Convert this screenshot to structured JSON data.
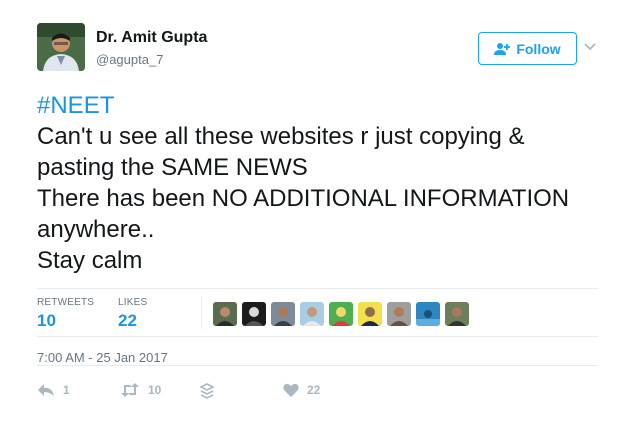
{
  "author": {
    "name": "Dr. Amit Gupta",
    "handle": "@agupta_7"
  },
  "follow_button": {
    "label": "Follow"
  },
  "tweet": {
    "hashtag": "#NEET",
    "lines": [
      "Can't u see all these websites r just copying &",
      "pasting the SAME NEWS",
      "There has been NO ADDITIONAL INFORMATION",
      "anywhere..",
      "Stay calm"
    ]
  },
  "stats": {
    "retweets_label": "RETWEETS",
    "retweets_value": "10",
    "likes_label": "LIKES",
    "likes_value": "22"
  },
  "liker_count_shown": 9,
  "timestamp": "7:00 AM - 25 Jan 2017",
  "actions": {
    "reply_count": "1",
    "retweet_count": "10",
    "like_count": "22"
  },
  "colors": {
    "accent": "#1da1f2",
    "link": "#1b95e0",
    "muted": "#657786",
    "icon": "#aab8c2"
  }
}
